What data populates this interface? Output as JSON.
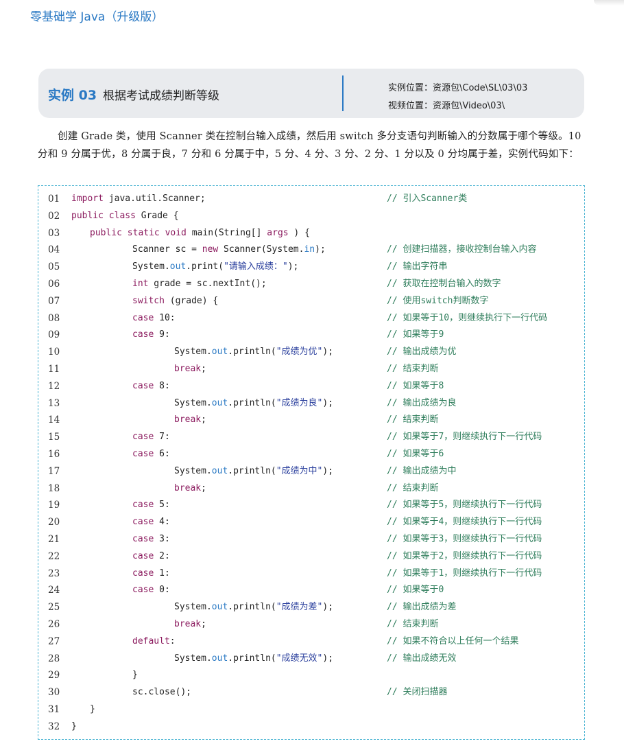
{
  "header": {
    "book_title": "零基础学 Java（升级版）"
  },
  "example": {
    "number": "实例 03",
    "title": "根据考试成绩判断等级",
    "location": "实例位置：资源包\\Code\\SL\\03\\03",
    "video": "视频位置：资源包\\Video\\03\\"
  },
  "intro_text": "创建 Grade 类，使用 Scanner 类在控制台输入成绩，然后用 switch 多分支语句判断输入的分数属于哪个等级。10 分和 9 分属于优，8 分属于良，7 分和 6 分属于中，5 分、4 分、3 分、2 分、1 分以及 0 分均属于差，实例代码如下：",
  "code_lines": [
    {
      "num": "01",
      "indent": 0,
      "segs": [
        [
          "kw",
          "import"
        ],
        [
          "",
          "java.util.Scanner;"
        ]
      ],
      "comment": "// 引入Scanner类"
    },
    {
      "num": "02",
      "indent": 0,
      "segs": [
        [
          "kw",
          "public class"
        ],
        [
          "",
          "Grade {"
        ]
      ],
      "comment": ""
    },
    {
      "num": "03",
      "indent": 1,
      "segs": [
        [
          "kw",
          "public static void"
        ],
        [
          "",
          "main(String[] "
        ],
        [
          "kw",
          "args"
        ],
        [
          "",
          " ) {"
        ]
      ],
      "comment": ""
    },
    {
      "num": "04",
      "indent": 2,
      "segs": [
        [
          "",
          "Scanner sc = "
        ],
        [
          "kw",
          "new"
        ],
        [
          "",
          " Scanner(System."
        ],
        [
          "fld",
          "in"
        ],
        [
          "",
          ");"
        ]
      ],
      "comment": "// 创建扫描器，接收控制台输入内容"
    },
    {
      "num": "05",
      "indent": 2,
      "segs": [
        [
          "",
          "System."
        ],
        [
          "fld",
          "out"
        ],
        [
          "",
          ".print("
        ],
        [
          "str",
          "\"请输入成绩：\""
        ],
        [
          "",
          ");"
        ]
      ],
      "comment": "// 输出字符串"
    },
    {
      "num": "06",
      "indent": 2,
      "segs": [
        [
          "kw",
          "int"
        ],
        [
          "",
          " grade = sc.nextInt();"
        ]
      ],
      "comment": "// 获取在控制台输入的数字"
    },
    {
      "num": "07",
      "indent": 2,
      "segs": [
        [
          "kw",
          "switch"
        ],
        [
          "",
          " (grade) {"
        ]
      ],
      "comment": "// 使用switch判断数字"
    },
    {
      "num": "08",
      "indent": 2,
      "segs": [
        [
          "kw",
          "case"
        ],
        [
          "",
          " 10:"
        ]
      ],
      "comment": "// 如果等于10，则继续执行下一行代码"
    },
    {
      "num": "09",
      "indent": 2,
      "segs": [
        [
          "kw",
          "case"
        ],
        [
          "",
          " 9:"
        ]
      ],
      "comment": "// 如果等于9"
    },
    {
      "num": "10",
      "indent": 3,
      "segs": [
        [
          "",
          "System."
        ],
        [
          "fld",
          "out"
        ],
        [
          "",
          ".println("
        ],
        [
          "str",
          "\"成绩为优\""
        ],
        [
          "",
          ");"
        ]
      ],
      "comment": "// 输出成绩为优"
    },
    {
      "num": "11",
      "indent": 3,
      "segs": [
        [
          "kw",
          "break"
        ],
        [
          "",
          ";"
        ]
      ],
      "comment": "// 结束判断"
    },
    {
      "num": "12",
      "indent": 2,
      "segs": [
        [
          "kw",
          "case"
        ],
        [
          "",
          " 8:"
        ]
      ],
      "comment": "// 如果等于8"
    },
    {
      "num": "13",
      "indent": 3,
      "segs": [
        [
          "",
          "System."
        ],
        [
          "fld",
          "out"
        ],
        [
          "",
          ".println("
        ],
        [
          "str",
          "\"成绩为良\""
        ],
        [
          "",
          ");"
        ]
      ],
      "comment": "// 输出成绩为良"
    },
    {
      "num": "14",
      "indent": 3,
      "segs": [
        [
          "kw",
          "break"
        ],
        [
          "",
          ";"
        ]
      ],
      "comment": "// 结束判断"
    },
    {
      "num": "15",
      "indent": 2,
      "segs": [
        [
          "kw",
          "case"
        ],
        [
          "",
          " 7:"
        ]
      ],
      "comment": "// 如果等于7，则继续执行下一行代码"
    },
    {
      "num": "16",
      "indent": 2,
      "segs": [
        [
          "kw",
          "case"
        ],
        [
          "",
          " 6:"
        ]
      ],
      "comment": "// 如果等于6"
    },
    {
      "num": "17",
      "indent": 3,
      "segs": [
        [
          "",
          "System."
        ],
        [
          "fld",
          "out"
        ],
        [
          "",
          ".println("
        ],
        [
          "str",
          "\"成绩为中\""
        ],
        [
          "",
          ");"
        ]
      ],
      "comment": "// 输出成绩为中"
    },
    {
      "num": "18",
      "indent": 3,
      "segs": [
        [
          "kw",
          "break"
        ],
        [
          "",
          ";"
        ]
      ],
      "comment": "// 结束判断"
    },
    {
      "num": "19",
      "indent": 2,
      "segs": [
        [
          "kw",
          "case"
        ],
        [
          "",
          " 5:"
        ]
      ],
      "comment": "// 如果等于5，则继续执行下一行代码"
    },
    {
      "num": "20",
      "indent": 2,
      "segs": [
        [
          "kw",
          "case"
        ],
        [
          "",
          " 4:"
        ]
      ],
      "comment": "// 如果等于4，则继续执行下一行代码"
    },
    {
      "num": "21",
      "indent": 2,
      "segs": [
        [
          "kw",
          "case"
        ],
        [
          "",
          " 3:"
        ]
      ],
      "comment": "// 如果等于3，则继续执行下一行代码"
    },
    {
      "num": "22",
      "indent": 2,
      "segs": [
        [
          "kw",
          "case"
        ],
        [
          "",
          " 2:"
        ]
      ],
      "comment": "// 如果等于2，则继续执行下一行代码"
    },
    {
      "num": "23",
      "indent": 2,
      "segs": [
        [
          "kw",
          "case"
        ],
        [
          "",
          " 1:"
        ]
      ],
      "comment": "// 如果等于1，则继续执行下一行代码"
    },
    {
      "num": "24",
      "indent": 2,
      "segs": [
        [
          "kw",
          "case"
        ],
        [
          "",
          " 0:"
        ]
      ],
      "comment": "// 如果等于0"
    },
    {
      "num": "25",
      "indent": 3,
      "segs": [
        [
          "",
          "System."
        ],
        [
          "fld",
          "out"
        ],
        [
          "",
          ".println("
        ],
        [
          "str",
          "\"成绩为差\""
        ],
        [
          "",
          ");"
        ]
      ],
      "comment": "// 输出成绩为差"
    },
    {
      "num": "26",
      "indent": 3,
      "segs": [
        [
          "kw",
          "break"
        ],
        [
          "",
          ";"
        ]
      ],
      "comment": "// 结束判断"
    },
    {
      "num": "27",
      "indent": 2,
      "segs": [
        [
          "kw",
          "default"
        ],
        [
          "",
          ":"
        ]
      ],
      "comment": "// 如果不符合以上任何一个结果"
    },
    {
      "num": "28",
      "indent": 3,
      "segs": [
        [
          "",
          "System."
        ],
        [
          "fld",
          "out"
        ],
        [
          "",
          ".println("
        ],
        [
          "str",
          "\"成绩无效\""
        ],
        [
          "",
          ");"
        ]
      ],
      "comment": "// 输出成绩无效"
    },
    {
      "num": "29",
      "indent": 2,
      "segs": [
        [
          "",
          "}"
        ]
      ],
      "comment": ""
    },
    {
      "num": "30",
      "indent": 2,
      "segs": [
        [
          "",
          "sc.close();"
        ]
      ],
      "comment": "// 关闭扫描器"
    },
    {
      "num": "31",
      "indent": 1,
      "segs": [
        [
          "",
          "}"
        ]
      ],
      "comment": ""
    },
    {
      "num": "32",
      "indent": 0,
      "segs": [
        [
          "",
          "}"
        ]
      ],
      "comment": ""
    }
  ]
}
